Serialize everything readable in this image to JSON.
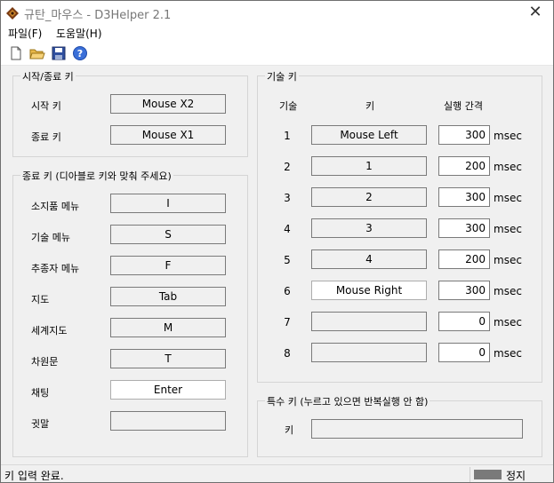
{
  "window": {
    "title": "규탄_마우스 - D3Helper 2.1"
  },
  "menu": {
    "file": "파일(F)",
    "help": "도움말(H)"
  },
  "icons": {
    "app": "app-diamond-icon",
    "close": "close-icon",
    "new": "new-file-icon",
    "open": "open-folder-icon",
    "save": "save-disk-icon",
    "help": "help-icon"
  },
  "start_stop": {
    "title": "시작/종료 키",
    "start_label": "시작 키",
    "start_value": "Mouse X2",
    "stop_label": "종료 키",
    "stop_value": "Mouse X1"
  },
  "stop_keys": {
    "title": "종료 키 (디아블로 키와 맞춰 주세요)",
    "items": [
      {
        "label": "소지품 메뉴",
        "value": "I"
      },
      {
        "label": "기술 메뉴",
        "value": "S"
      },
      {
        "label": "추종자 메뉴",
        "value": "F"
      },
      {
        "label": "지도",
        "value": "Tab"
      },
      {
        "label": "세계지도",
        "value": "M"
      },
      {
        "label": "차원문",
        "value": "T"
      },
      {
        "label": "채팅",
        "value": "Enter"
      },
      {
        "label": "귓말",
        "value": ""
      }
    ]
  },
  "skill_keys": {
    "title": "기술 키",
    "col_skill": "기술",
    "col_key": "키",
    "col_interval": "실행 간격",
    "unit": "msec",
    "rows": [
      {
        "num": "1",
        "key": "Mouse Left",
        "interval": "300"
      },
      {
        "num": "2",
        "key": "1",
        "interval": "200"
      },
      {
        "num": "3",
        "key": "2",
        "interval": "300"
      },
      {
        "num": "4",
        "key": "3",
        "interval": "300"
      },
      {
        "num": "5",
        "key": "4",
        "interval": "200"
      },
      {
        "num": "6",
        "key": "Mouse Right",
        "interval": "300"
      },
      {
        "num": "7",
        "key": "",
        "interval": "0"
      },
      {
        "num": "8",
        "key": "",
        "interval": "0"
      }
    ]
  },
  "special_key": {
    "title": "특수 키 (누르고 있으면 반복실행 안 함)",
    "label": "키",
    "value": ""
  },
  "status": {
    "message": "키 입력 완료.",
    "state": "정지"
  }
}
